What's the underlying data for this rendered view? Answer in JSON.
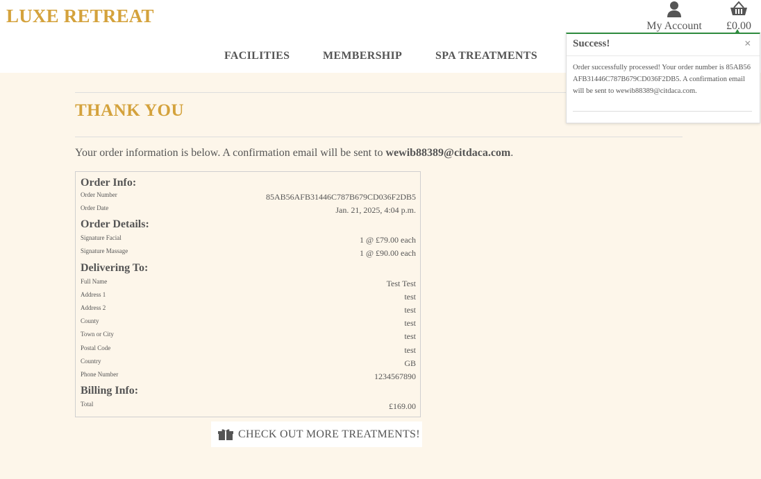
{
  "brand": {
    "name": "LUXE RETREAT",
    "color": "#d4a23c"
  },
  "header": {
    "account": {
      "label": "My Account",
      "icon": "user-icon"
    },
    "cart": {
      "total": "£0.00",
      "icon": "basket-icon"
    }
  },
  "nav": {
    "items": [
      "FACILITIES",
      "MEMBERSHIP",
      "SPA TREATMENTS"
    ]
  },
  "main": {
    "title": "THANK YOU",
    "intro_text": "Your order information is below. A confirmation email will be sent to",
    "email": "wewib88389@citdaca.com",
    "intro_end": "."
  },
  "order": {
    "info_title": "Order Info:",
    "number_label": "Order Number",
    "number": "85AB56AFB31446C787B679CD036F2DB5",
    "date_label": "Order Date",
    "date": "Jan. 21, 2025, 4:04 p.m.",
    "details_title": "Order Details:",
    "items": [
      {
        "name": "Signature Facial",
        "qty": "1 @ £79.00 each"
      },
      {
        "name": "Signature Massage",
        "qty": "1 @ £90.00 each"
      }
    ],
    "delivery_title": "Delivering To:",
    "delivery": [
      {
        "label": "Full Name",
        "value": "Test Test"
      },
      {
        "label": "Address 1",
        "value": "test"
      },
      {
        "label": "Address 2",
        "value": "test"
      },
      {
        "label": "County",
        "value": "test"
      },
      {
        "label": "Town or City",
        "value": "test"
      },
      {
        "label": "Postal Code",
        "value": "test"
      },
      {
        "label": "Country",
        "value": "GB"
      },
      {
        "label": "Phone Number",
        "value": "1234567890"
      }
    ],
    "billing_title": "Billing Info:",
    "total_label": "Total",
    "total": "£169.00"
  },
  "cta": {
    "label": "CHECK OUT MORE TREATMENTS!",
    "icon": "gift-icon"
  },
  "toast": {
    "title": "Success!",
    "close": "×",
    "message": "Order successfully processed! Your order number is 85AB56AFB31446C787B679CD036F2DB5. A confirmation email will be sent to wewib88389@citdaca.com.",
    "accent": "#2e8b3e"
  }
}
